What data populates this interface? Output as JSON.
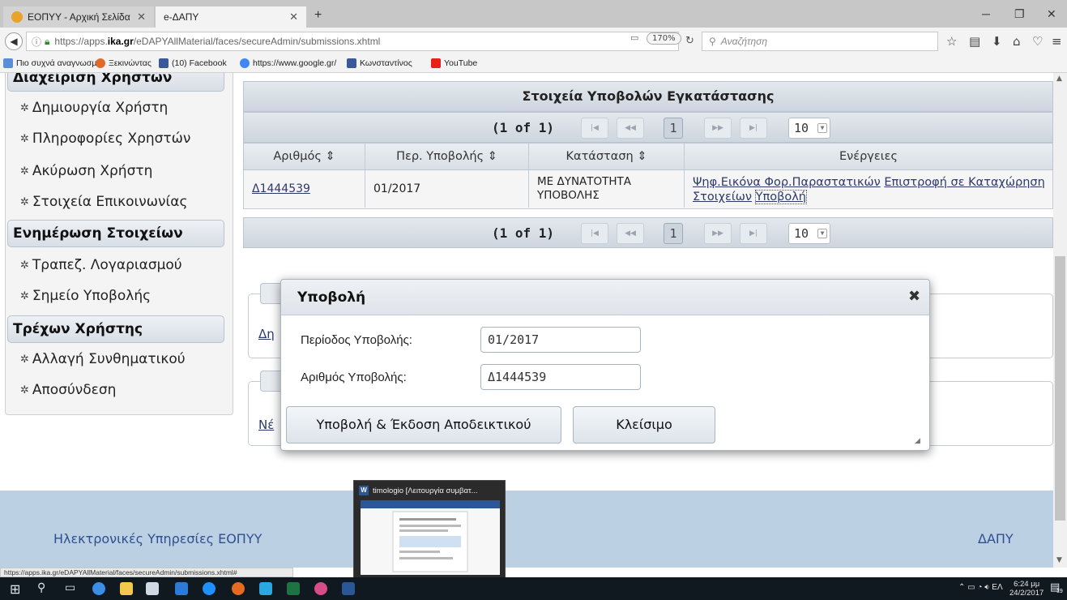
{
  "browser": {
    "tabs": [
      {
        "label": "ΕΟΠΥΥ - Αρχική Σελίδα",
        "active": false
      },
      {
        "label": "e-ΔΑΠΥ",
        "active": true
      }
    ],
    "new_tab": "+",
    "url_prefix": "https://apps.",
    "url_host": "ika.gr",
    "url_path": "/eDAPYAllMaterial/faces/secureAdmin/submissions.xhtml",
    "zoom": "170%",
    "search_placeholder": "Αναζήτηση",
    "bookmarks": [
      "Πιο συχνά αναγνωσμ...",
      "Ξεκινώντας",
      "(10) Facebook",
      "https://www.google.gr/",
      "Κωνσταντίνος",
      "YouTube"
    ]
  },
  "sidebar": {
    "group1_title": "Διαχείριση Χρηστών",
    "group1_items": [
      "Δημιουργία Χρήστη",
      "Πληροφορίες Χρηστών",
      "Ακύρωση Χρήστη",
      "Στοιχεία Επικοινωνίας"
    ],
    "group2_title": "Ενημέρωση Στοιχείων",
    "group2_items": [
      "Τραπεζ. Λογαριασμού",
      "Σημείο Υποβολής"
    ],
    "group3_title": "Τρέχων Χρήστης",
    "group3_items": [
      "Αλλαγή Συνθηματικού",
      "Αποσύνδεση"
    ]
  },
  "table": {
    "title": "Στοιχεία Υποβολών Εγκατάστασης",
    "pager_text": "(1 of 1)",
    "current_page": "1",
    "page_size": "10",
    "columns": [
      "Αριθμός ⇕",
      "Περ. Υποβολής ⇕",
      "Κατάσταση ⇕",
      "Ενέργειες"
    ],
    "rows": [
      {
        "number": "Δ1444539",
        "period": "01/2017",
        "status": "ΜΕ ΔΥΝΑΤΟΤΗΤΑ ΥΠΟΒΟΛΗΣ",
        "action1": "Ψηφ.Εικόνα Φορ.Παραστατικών",
        "action2": "Επιστροφή σε Καταχώρηση Στοιχείων",
        "action3": "Υποβολή"
      }
    ]
  },
  "background_links": [
    "Δη",
    "Νέ"
  ],
  "dialog": {
    "title": "Υποβολή",
    "close": "✖",
    "period_label": "Περίοδος Υποβολής:",
    "period_value": "01/2017",
    "number_label": "Αριθμός Υποβολής:",
    "number_value": "Δ1444539",
    "submit_button": "Υποβολή & Έκδοση Αποδεικτικού",
    "close_button": "Κλείσιμο"
  },
  "footer": {
    "left": "Ηλεκτρονικές Υπηρεσίες ΕΟΠΥΥ",
    "right": "ΔΑΠΥ"
  },
  "statusbar": "https://apps.ika.gr/eDAPYAllMaterial/faces/secureAdmin/submissions.xhtml#",
  "taskbar": {
    "thumb_title": "timologio [Λειτουργία συμβατ...",
    "tray_lang": "ΕΛ",
    "clock_time": "6:24 μμ",
    "clock_date": "24/2/2017",
    "notif_count": "19"
  }
}
